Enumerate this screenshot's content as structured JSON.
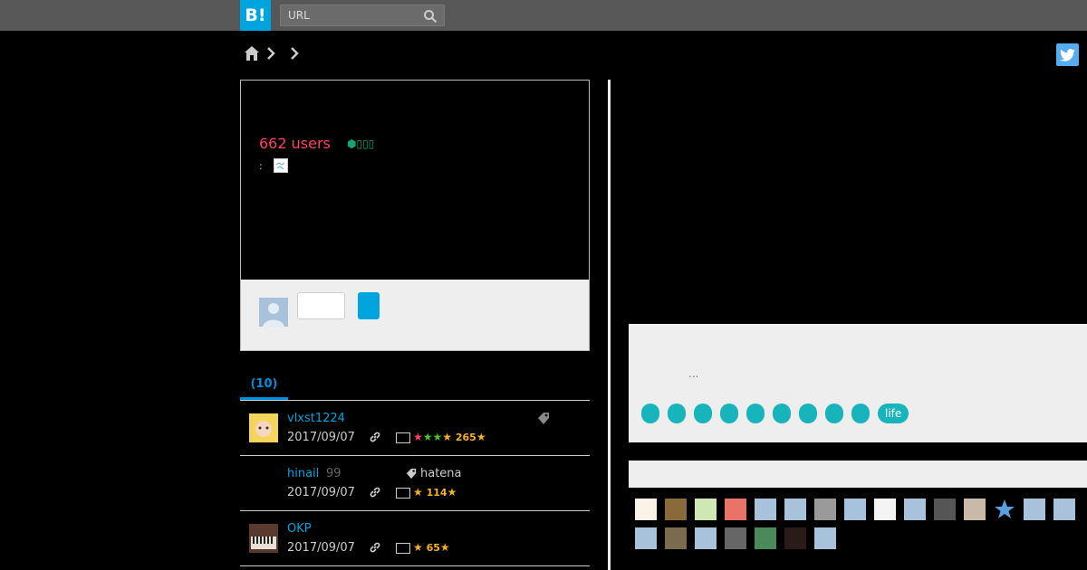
{
  "header": {
    "logo": "B!",
    "search_placeholder": "URL"
  },
  "breadcrumb": {
    "home": "home-icon"
  },
  "entry": {
    "users": "662 users",
    "badge": "⬢▯▯▯",
    "meta_prefix": ":"
  },
  "tabs": [
    {
      "label": "(10)"
    }
  ],
  "bookmarks": [
    {
      "name": "vlxst1224",
      "count": "",
      "tag": "",
      "date": "2017/09/07",
      "stars": "265"
    },
    {
      "name": "hinail",
      "count": "99",
      "tag": "hatena",
      "date": "2017/09/07",
      "stars": "114"
    },
    {
      "name": "OKP",
      "count": "",
      "tag": "",
      "date": "2017/09/07",
      "stars": "65"
    }
  ],
  "right": {
    "ellipsis": "...",
    "tag_pill": "life"
  },
  "colors": {
    "accent": "#00a4de",
    "users": "#ff4166",
    "tag": "#17b4bb",
    "star": "#f4b128"
  }
}
